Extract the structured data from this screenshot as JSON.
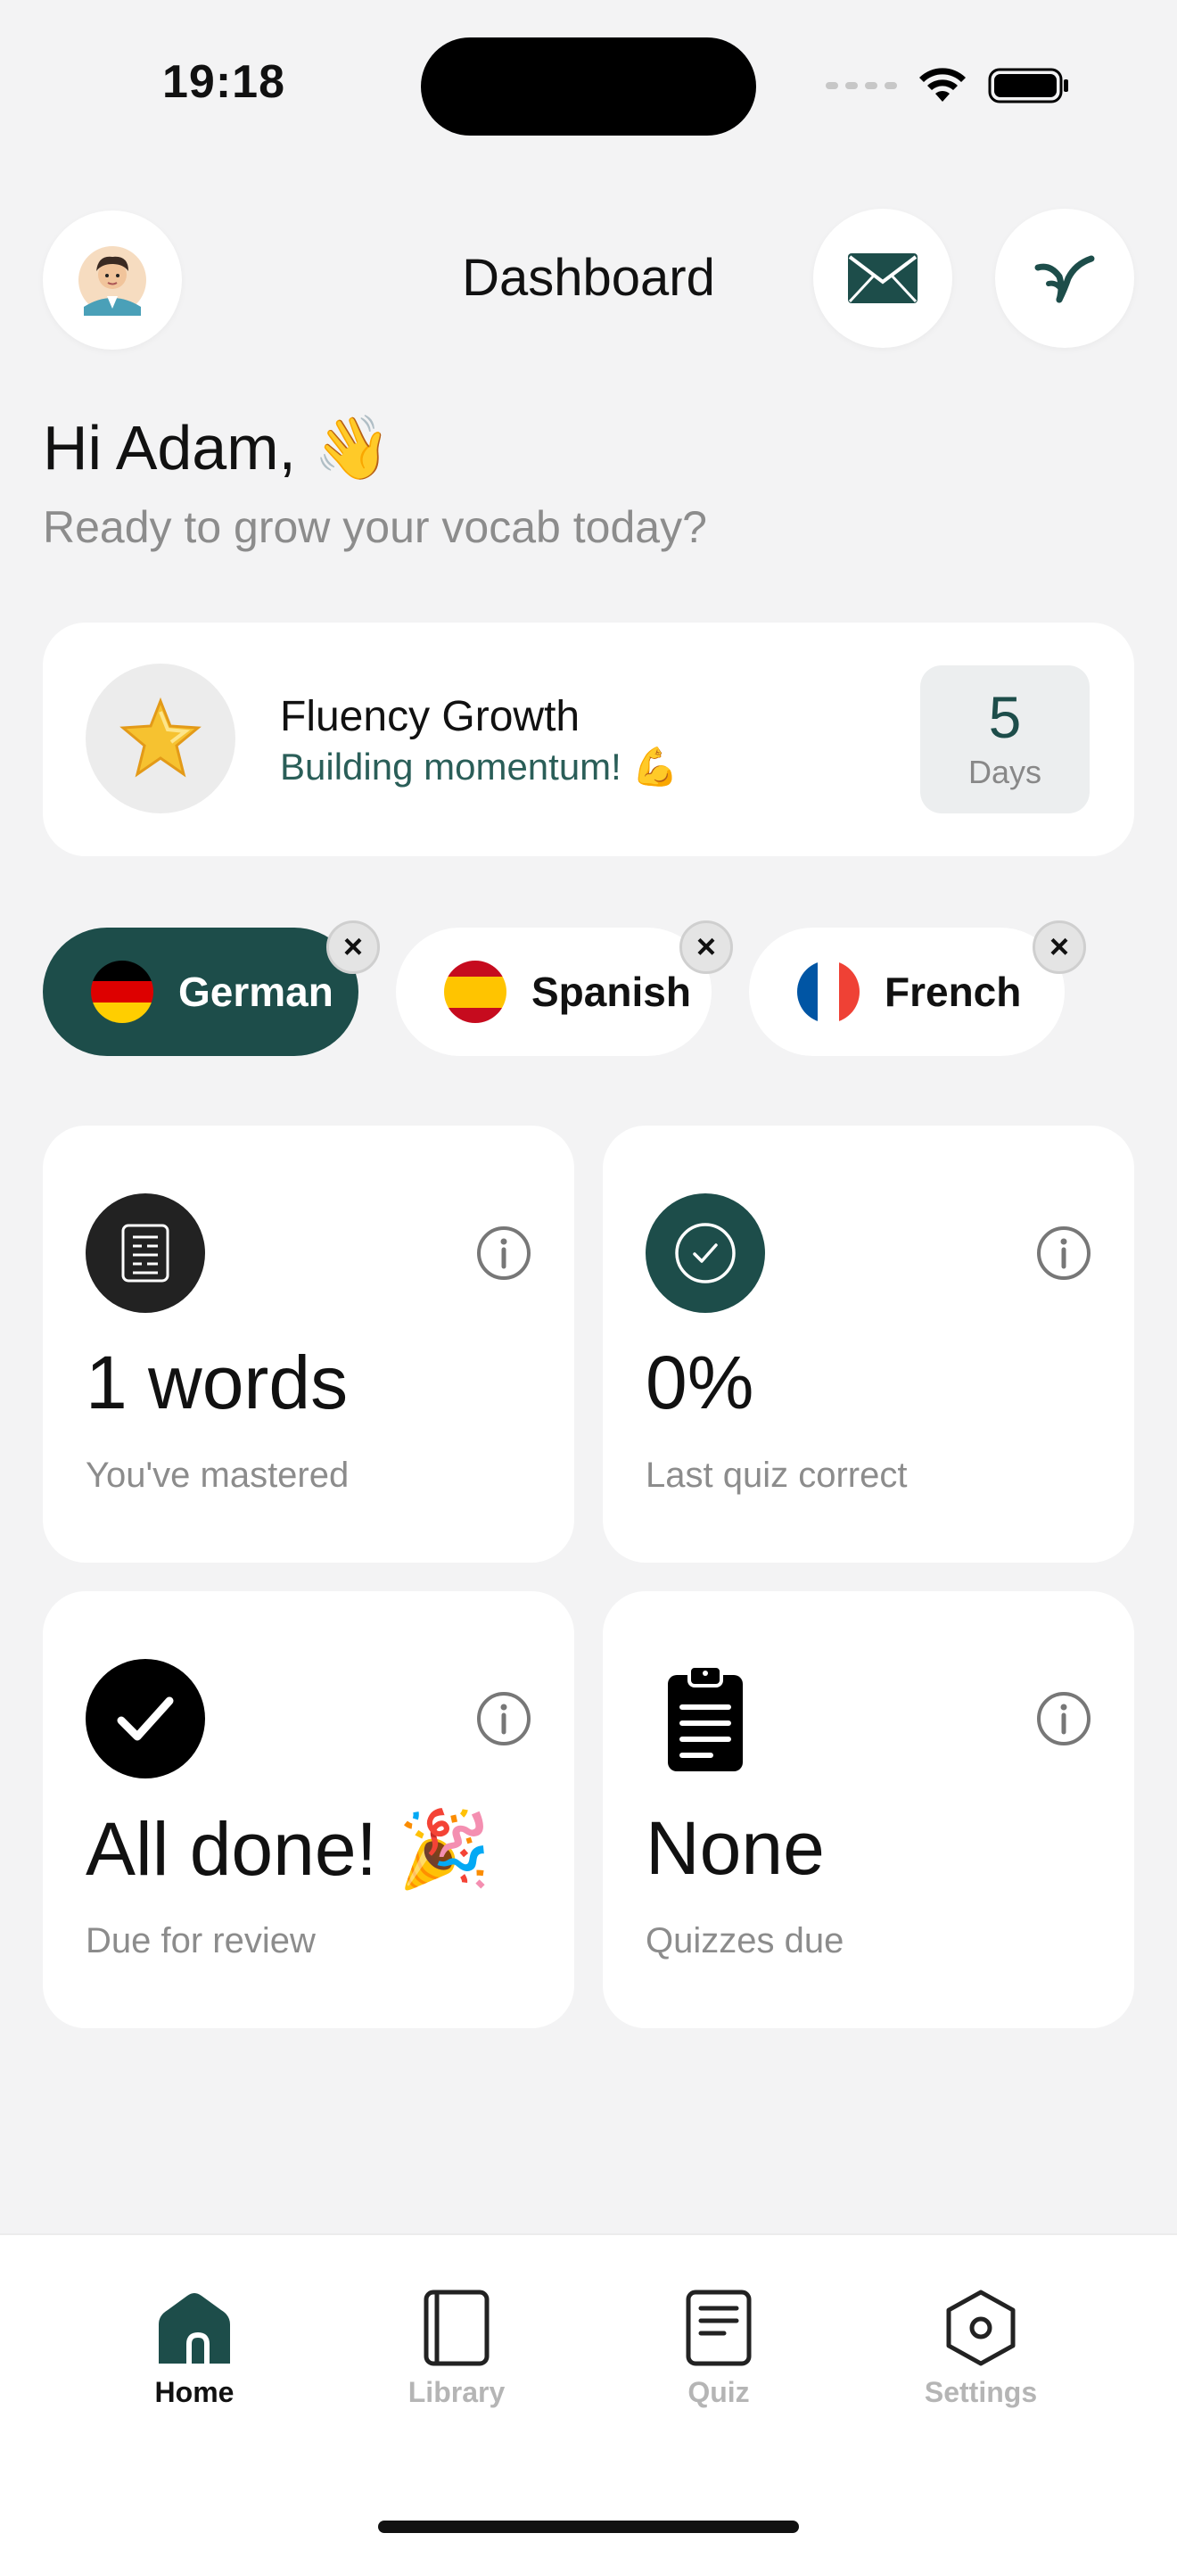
{
  "status_bar": {
    "time": "19:18"
  },
  "header": {
    "title": "Dashboard"
  },
  "greeting": {
    "title": "Hi Adam,",
    "emoji": "👋",
    "subtitle": "Ready to grow your vocab today?"
  },
  "streak": {
    "title": "Fluency Growth",
    "subtitle": "Building momentum! 💪",
    "days_value": "5",
    "days_label": "Days",
    "icon": "star-icon"
  },
  "languages": [
    {
      "name": "German",
      "active": true
    },
    {
      "name": "Spanish",
      "active": false
    },
    {
      "name": "French",
      "active": false
    }
  ],
  "stats": {
    "mastered": {
      "value": "1 words",
      "label": "You've mastered",
      "icon": "document-icon"
    },
    "quiz": {
      "value": "0%",
      "label": "Last quiz correct",
      "icon": "check-circle-icon"
    },
    "review": {
      "value": "All done! 🎉",
      "label": "Due for review",
      "icon": "checkmark-icon"
    },
    "quizzes_due": {
      "value": "None",
      "label": "Quizzes due",
      "icon": "clipboard-icon"
    }
  },
  "nav": [
    {
      "label": "Home",
      "icon": "home-icon",
      "active": true
    },
    {
      "label": "Library",
      "icon": "library-icon",
      "active": false
    },
    {
      "label": "Quiz",
      "icon": "quiz-icon",
      "active": false
    },
    {
      "label": "Settings",
      "icon": "settings-icon",
      "active": false
    }
  ],
  "colors": {
    "accent": "#1d4d4a",
    "background": "#f3f3f4",
    "muted": "#8c8c8c"
  }
}
